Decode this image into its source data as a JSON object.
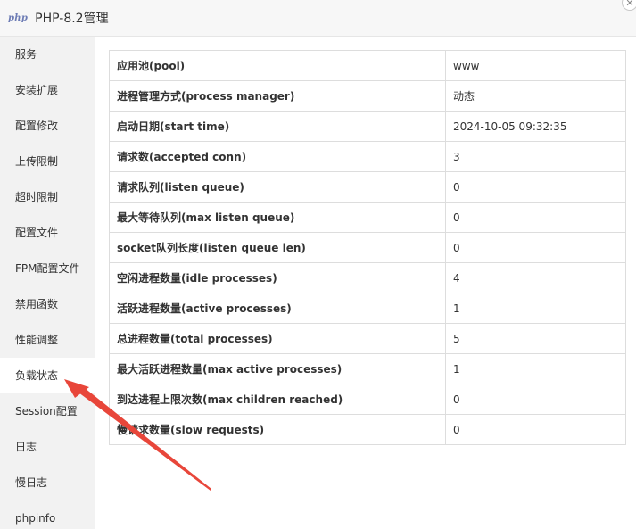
{
  "window": {
    "logo_text": "php",
    "title": "PHP-8.2管理",
    "close_glyph": "✕"
  },
  "sidebar": {
    "items": [
      {
        "label": "服务"
      },
      {
        "label": "安装扩展"
      },
      {
        "label": "配置修改"
      },
      {
        "label": "上传限制"
      },
      {
        "label": "超时限制"
      },
      {
        "label": "配置文件"
      },
      {
        "label": "FPM配置文件"
      },
      {
        "label": "禁用函数"
      },
      {
        "label": "性能调整"
      },
      {
        "label": "负载状态"
      },
      {
        "label": "Session配置"
      },
      {
        "label": "日志"
      },
      {
        "label": "慢日志"
      },
      {
        "label": "phpinfo"
      }
    ],
    "active_label": "负载状态"
  },
  "status_table": {
    "rows": [
      {
        "key": "应用池(pool)",
        "value": "www"
      },
      {
        "key": "进程管理方式(process manager)",
        "value": "动态"
      },
      {
        "key": "启动日期(start time)",
        "value": "2024-10-05 09:32:35"
      },
      {
        "key": "请求数(accepted conn)",
        "value": "3"
      },
      {
        "key": "请求队列(listen queue)",
        "value": "0"
      },
      {
        "key": "最大等待队列(max listen queue)",
        "value": "0"
      },
      {
        "key": "socket队列长度(listen queue len)",
        "value": "0"
      },
      {
        "key": "空闲进程数量(idle processes)",
        "value": "4"
      },
      {
        "key": "活跃进程数量(active processes)",
        "value": "1"
      },
      {
        "key": "总进程数量(total processes)",
        "value": "5"
      },
      {
        "key": "最大活跃进程数量(max active processes)",
        "value": "1"
      },
      {
        "key": "到达进程上限次数(max children reached)",
        "value": "0"
      },
      {
        "key": "慢请求数量(slow requests)",
        "value": "0"
      }
    ]
  },
  "annotation": {
    "color": "#e8463a",
    "points_to": "负载状态"
  }
}
